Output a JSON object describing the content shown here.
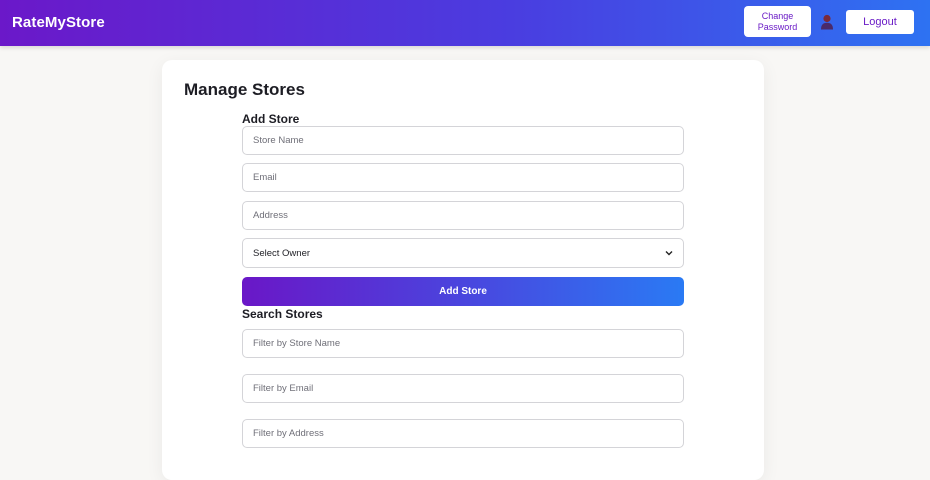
{
  "navbar": {
    "brand": "RateMyStore",
    "change_password_label": "Change\nPassword",
    "logout_label": "Logout",
    "avatar_icon": "user-avatar-icon"
  },
  "page": {
    "title": "Manage Stores"
  },
  "add_store": {
    "title": "Add Store",
    "store_name_placeholder": "Store Name",
    "email_placeholder": "Email",
    "address_placeholder": "Address",
    "owner_select_value": "Select Owner",
    "submit_label": "Add Store"
  },
  "search_stores": {
    "title": "Search Stores",
    "name_filter_placeholder": "Filter by Store Name",
    "email_filter_placeholder": "Filter by Email",
    "address_filter_placeholder": "Filter by Address"
  },
  "colors": {
    "gradient_start": "#6b18c9",
    "gradient_end": "#2e72f2",
    "accent_text": "#6a1bc6"
  }
}
